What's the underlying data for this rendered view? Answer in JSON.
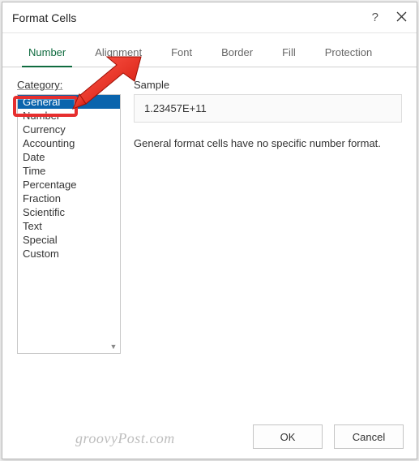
{
  "dialog": {
    "title": "Format Cells",
    "help_icon": "?",
    "close_icon": "×"
  },
  "tabs": {
    "items": [
      {
        "label": "Number",
        "active": true
      },
      {
        "label": "Alignment",
        "active": false
      },
      {
        "label": "Font",
        "active": false
      },
      {
        "label": "Border",
        "active": false
      },
      {
        "label": "Fill",
        "active": false
      },
      {
        "label": "Protection",
        "active": false
      }
    ]
  },
  "category": {
    "label": "Category:",
    "items": [
      {
        "label": "General",
        "selected": true
      },
      {
        "label": "Number",
        "selected": false
      },
      {
        "label": "Currency",
        "selected": false
      },
      {
        "label": "Accounting",
        "selected": false
      },
      {
        "label": "Date",
        "selected": false
      },
      {
        "label": "Time",
        "selected": false
      },
      {
        "label": "Percentage",
        "selected": false
      },
      {
        "label": "Fraction",
        "selected": false
      },
      {
        "label": "Scientific",
        "selected": false
      },
      {
        "label": "Text",
        "selected": false
      },
      {
        "label": "Special",
        "selected": false
      },
      {
        "label": "Custom",
        "selected": false
      }
    ]
  },
  "sample": {
    "label": "Sample",
    "value": "1.23457E+11"
  },
  "description": "General format cells have no specific number format.",
  "buttons": {
    "ok": "OK",
    "cancel": "Cancel"
  },
  "watermark": "groovyPost.com",
  "callout": {
    "highlight_target": "Number",
    "arrow_color": "#e62e2e"
  }
}
